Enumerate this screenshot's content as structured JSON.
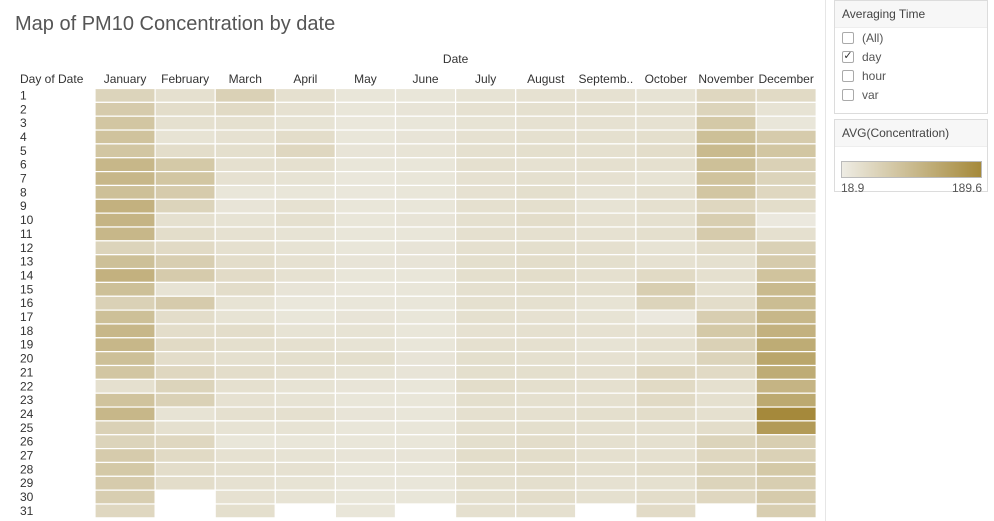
{
  "title": "Map of PM10 Concentration by date",
  "filter": {
    "title": "Averaging Time",
    "options": [
      {
        "label": "(All)",
        "checked": false
      },
      {
        "label": "day",
        "checked": true
      },
      {
        "label": "hour",
        "checked": false
      },
      {
        "label": "var",
        "checked": false
      }
    ]
  },
  "legend": {
    "title": "AVG(Concentration)",
    "min_label": "18.9",
    "max_label": "189.6",
    "color_min": "#eeece4",
    "color_max": "#a5893a"
  },
  "chart_data": {
    "type": "heatmap",
    "title": "Map of PM10 Concentration by date",
    "column_header": "Date",
    "row_header": "Day of Date",
    "columns": [
      "January",
      "February",
      "March",
      "April",
      "May",
      "June",
      "July",
      "August",
      "Septemb..",
      "October",
      "November",
      "December"
    ],
    "rows": [
      "1",
      "2",
      "3",
      "4",
      "5",
      "6",
      "7",
      "8",
      "9",
      "10",
      "11",
      "12",
      "13",
      "14",
      "15",
      "16",
      "17",
      "18",
      "19",
      "20",
      "21",
      "22",
      "23",
      "24",
      "25",
      "26",
      "27",
      "28",
      "29",
      "30",
      "31"
    ],
    "color_range": [
      18.9,
      189.6
    ],
    "values": [
      [
        60,
        40,
        65,
        40,
        30,
        30,
        35,
        38,
        38,
        35,
        55,
        50
      ],
      [
        75,
        45,
        50,
        38,
        30,
        32,
        38,
        40,
        40,
        40,
        60,
        35
      ],
      [
        85,
        40,
        40,
        35,
        28,
        30,
        35,
        38,
        38,
        38,
        80,
        30
      ],
      [
        90,
        35,
        38,
        45,
        30,
        32,
        38,
        40,
        40,
        42,
        95,
        75
      ],
      [
        85,
        45,
        42,
        55,
        32,
        33,
        40,
        42,
        40,
        45,
        105,
        85
      ],
      [
        110,
        80,
        40,
        40,
        30,
        30,
        40,
        38,
        40,
        40,
        95,
        65
      ],
      [
        110,
        85,
        38,
        35,
        28,
        30,
        38,
        40,
        38,
        35,
        90,
        60
      ],
      [
        95,
        75,
        30,
        30,
        28,
        30,
        38,
        42,
        35,
        40,
        85,
        55
      ],
      [
        120,
        60,
        32,
        38,
        30,
        30,
        40,
        42,
        35,
        40,
        55,
        45
      ],
      [
        115,
        40,
        35,
        40,
        30,
        32,
        40,
        45,
        38,
        40,
        70,
        25
      ],
      [
        110,
        45,
        38,
        35,
        30,
        30,
        40,
        40,
        38,
        42,
        75,
        40
      ],
      [
        60,
        50,
        40,
        35,
        30,
        32,
        40,
        42,
        40,
        35,
        45,
        65
      ],
      [
        95,
        70,
        45,
        38,
        32,
        32,
        42,
        45,
        42,
        38,
        40,
        75
      ],
      [
        120,
        75,
        48,
        38,
        30,
        30,
        42,
        45,
        40,
        50,
        40,
        90
      ],
      [
        95,
        35,
        45,
        32,
        28,
        30,
        40,
        42,
        40,
        70,
        40,
        105
      ],
      [
        65,
        75,
        35,
        28,
        30,
        30,
        40,
        40,
        35,
        60,
        45,
        100
      ],
      [
        95,
        45,
        35,
        30,
        32,
        30,
        40,
        38,
        35,
        25,
        70,
        110
      ],
      [
        110,
        45,
        45,
        35,
        35,
        30,
        38,
        40,
        38,
        40,
        80,
        120
      ],
      [
        110,
        50,
        42,
        40,
        35,
        30,
        40,
        40,
        35,
        40,
        65,
        130
      ],
      [
        95,
        45,
        40,
        42,
        42,
        32,
        42,
        40,
        38,
        40,
        60,
        140
      ],
      [
        85,
        55,
        45,
        40,
        35,
        32,
        42,
        42,
        40,
        55,
        50,
        130
      ],
      [
        40,
        60,
        40,
        35,
        32,
        30,
        45,
        42,
        40,
        50,
        40,
        115
      ],
      [
        90,
        65,
        38,
        35,
        30,
        30,
        42,
        40,
        40,
        50,
        40,
        135
      ],
      [
        110,
        35,
        40,
        40,
        32,
        30,
        40,
        40,
        42,
        45,
        40,
        189
      ],
      [
        65,
        40,
        35,
        35,
        30,
        30,
        40,
        42,
        40,
        40,
        45,
        160
      ],
      [
        60,
        55,
        30,
        30,
        30,
        30,
        42,
        45,
        40,
        40,
        60,
        70
      ],
      [
        75,
        50,
        38,
        35,
        32,
        32,
        45,
        45,
        40,
        40,
        55,
        65
      ],
      [
        80,
        45,
        40,
        38,
        30,
        30,
        42,
        45,
        40,
        45,
        60,
        80
      ],
      [
        75,
        45,
        38,
        35,
        30,
        30,
        40,
        42,
        38,
        40,
        60,
        70
      ],
      [
        70,
        null,
        38,
        35,
        30,
        30,
        40,
        45,
        40,
        45,
        55,
        75
      ],
      [
        55,
        null,
        42,
        null,
        30,
        null,
        40,
        40,
        null,
        48,
        null,
        70
      ]
    ]
  }
}
